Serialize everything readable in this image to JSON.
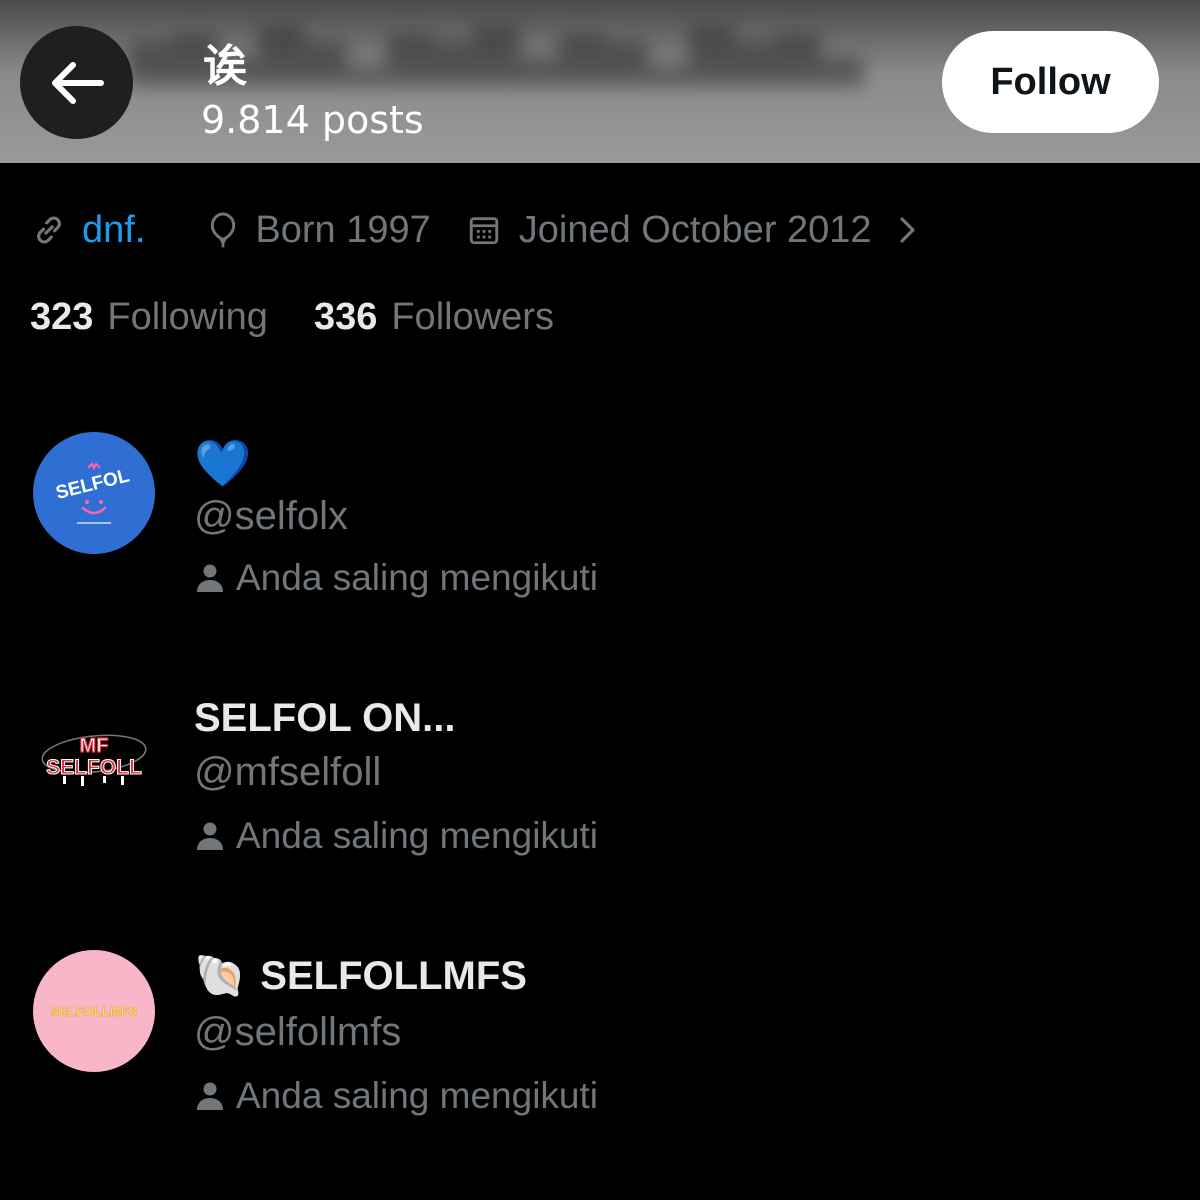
{
  "header": {
    "profile_name": "诶",
    "post_count": "9.814 posts",
    "follow_label": "Follow",
    "back_icon": "arrow-left-icon"
  },
  "profile_meta": {
    "link_icon": "link-icon",
    "link_text": "dnf.",
    "born_icon": "balloon-icon",
    "born_text": "Born 1997",
    "joined_icon": "calendar-icon",
    "joined_text": "Joined October 2012",
    "more_icon": "chevron-right-icon"
  },
  "stats": {
    "following_count": "323",
    "following_label": "Following",
    "followers_count": "336",
    "followers_label": "Followers"
  },
  "accounts": [
    {
      "display_name": "💙",
      "handle": "@selfolx",
      "mutual_text": "Anda saling mengikuti",
      "avatar_text": "SELFOL",
      "avatar_bg": "#2f6fd4"
    },
    {
      "display_name": "SELFOL ON...",
      "handle": "@mfselfoll",
      "mutual_text": "Anda saling mengikuti",
      "avatar_text_top": "MF",
      "avatar_text_bottom": "SELFOLL",
      "avatar_bg": "#000000"
    },
    {
      "display_name_emoji": "🐚",
      "display_name": "SELFOLLMFS",
      "handle": "@selfollmfs",
      "mutual_text": "Anda saling mengikuti",
      "avatar_text": "SELFOLLMFS",
      "avatar_bg": "#f8b6c8"
    }
  ],
  "colors": {
    "background": "#000000",
    "primary_text": "#e7e9ea",
    "secondary_text": "#71767b",
    "link": "#1d9bf0"
  }
}
